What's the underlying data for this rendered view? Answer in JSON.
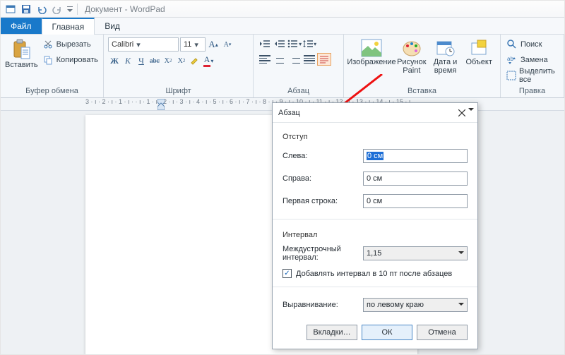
{
  "title": {
    "doc": "Документ",
    "app": "WordPad"
  },
  "tabs": {
    "file": "Файл",
    "home": "Главная",
    "view": "Вид"
  },
  "ribbon": {
    "clipboard": {
      "paste": "Вставить",
      "cut": "Вырезать",
      "copy": "Копировать",
      "label": "Буфер обмена"
    },
    "font": {
      "name": "Calibri",
      "size": "11",
      "label": "Шрифт"
    },
    "paragraph": {
      "label": "Абзац"
    },
    "insert": {
      "image": "Изображение",
      "paint": "Рисунок Paint",
      "datetime": "Дата и время",
      "object": "Объект",
      "label": "Вставка"
    },
    "editing": {
      "find": "Поиск",
      "replace": "Замена",
      "selectall": "Выделить все",
      "label": "Правка"
    }
  },
  "ruler_text": "3 · ı · 2 · ı · 1 · ı · · ı · 1 · ı · 2 · ı · 3 · ı · 4 · ı · 5 · ı · 6 · ı · 7 · ı · 8 · ı · 9 · ı · 10 · ı · 11 · ı · 12 · ı · 13 · ı · 14 · ı · 15 · ı",
  "dialog": {
    "title": "Абзац",
    "indent_section": "Отступ",
    "left_label": "Слева:",
    "left_value": "0 см",
    "right_label": "Справа:",
    "right_value": "0 см",
    "firstline_label": "Первая строка:",
    "firstline_value": "0 см",
    "spacing_section": "Интервал",
    "linespacing_label": "Междустрочный интервал:",
    "linespacing_value": "1,15",
    "add_space_label": "Добавлять интервал в 10 пт после абзацев",
    "alignment_label": "Выравнивание:",
    "alignment_value": "по левому краю",
    "tabs_btn": "Вкладки…",
    "ok_btn": "ОК",
    "cancel_btn": "Отмена"
  }
}
